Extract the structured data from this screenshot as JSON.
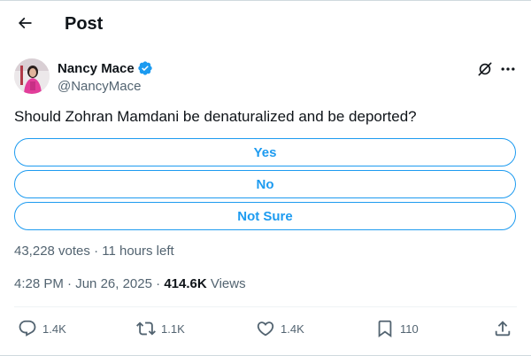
{
  "header": {
    "title": "Post",
    "back_icon": "arrow-left-icon"
  },
  "author": {
    "display_name": "Nancy Mace",
    "handle": "@NancyMace",
    "verified": true,
    "verified_color": "#1d9bf0"
  },
  "post": {
    "text": "Should Zohran Mamdani be denaturalized and be deported?"
  },
  "poll": {
    "options": [
      {
        "label": "Yes"
      },
      {
        "label": "No"
      },
      {
        "label": "Not Sure"
      }
    ],
    "votes": "43,228 votes",
    "separator": "·",
    "time_left": "11 hours left"
  },
  "meta": {
    "time": "4:28 PM",
    "date": "Jun 26, 2025",
    "separator": "·",
    "views_count": "414.6K",
    "views_label": "Views"
  },
  "actions": {
    "reply_count": "1.4K",
    "repost_count": "1.1K",
    "like_count": "1.4K",
    "bookmark_count": "110"
  },
  "colors": {
    "accent": "#1d9bf0",
    "text_primary": "#0f1419",
    "text_secondary": "#536471"
  }
}
